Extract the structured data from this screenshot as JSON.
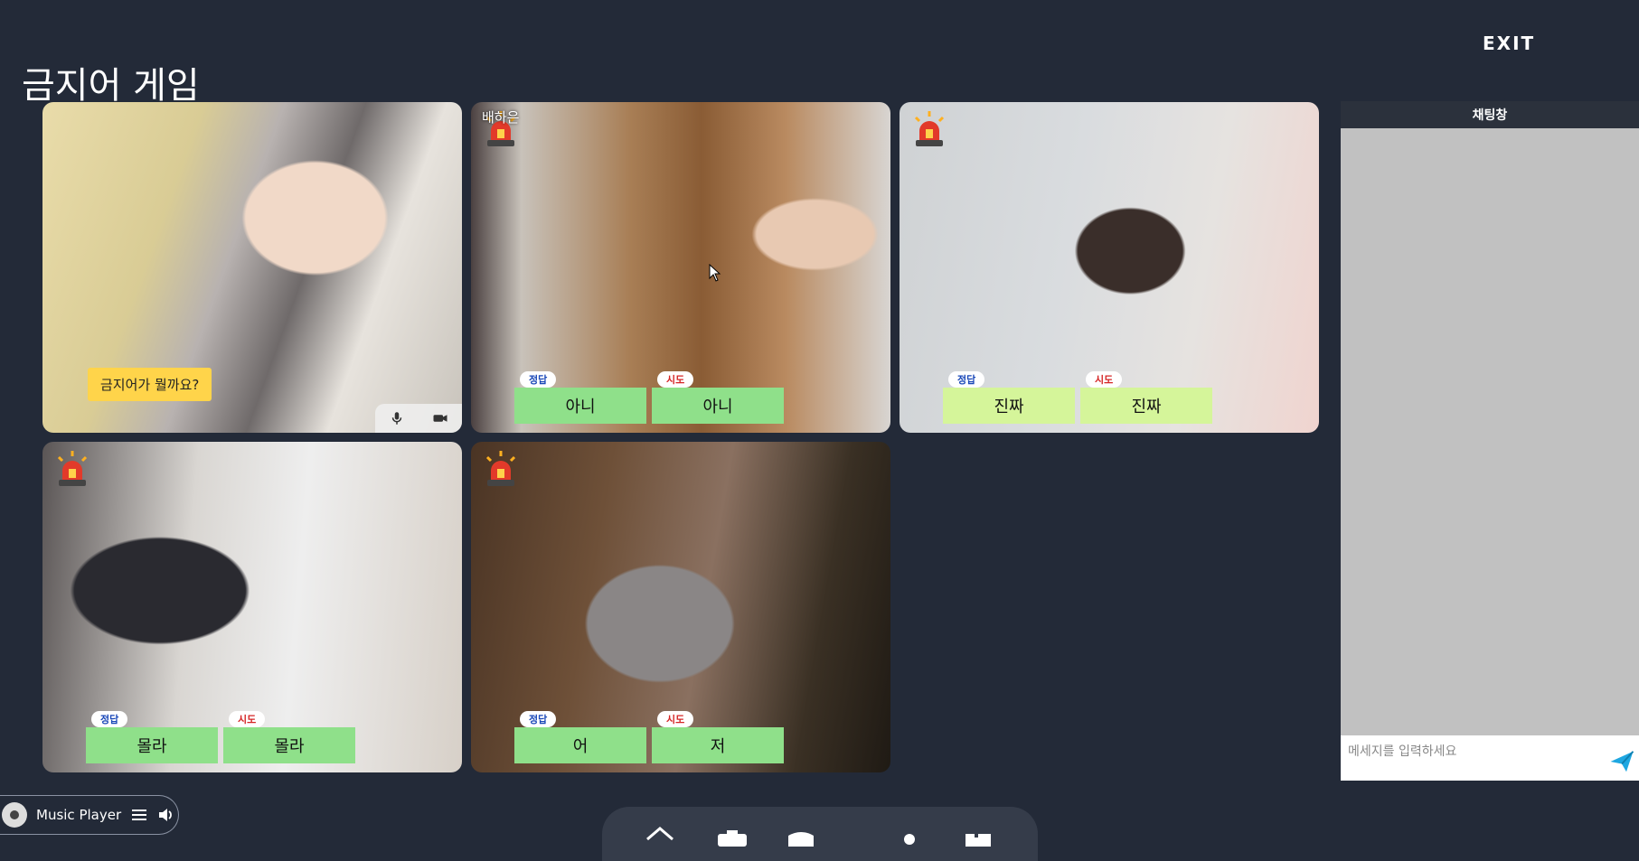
{
  "header": {
    "exit_label": "EXIT",
    "title": "금지어 게임"
  },
  "tiles": [
    {
      "name": "",
      "question": "금지어가 뭘까요?",
      "show_controls": true
    },
    {
      "name": "배하은",
      "correct_tag": "정답",
      "correct_answer": "아니",
      "attempt_tag": "시도",
      "attempt_answer": "아니"
    },
    {
      "name": "",
      "correct_tag": "정답",
      "correct_answer": "진짜",
      "attempt_tag": "시도",
      "attempt_answer": "진짜"
    },
    {
      "name": "",
      "correct_tag": "정답",
      "correct_answer": "몰라",
      "attempt_tag": "시도",
      "attempt_answer": "몰라"
    },
    {
      "name": "",
      "correct_tag": "정답",
      "correct_answer": "어",
      "attempt_tag": "시도",
      "attempt_answer": "저"
    }
  ],
  "chat": {
    "title": "채팅창",
    "placeholder": "메세지를 입력하세요"
  },
  "music_player": {
    "label": "Music Player"
  },
  "icons": {
    "siren": "siren-icon",
    "mic": "microphone-icon",
    "camera": "video-camera-icon",
    "send": "send-icon",
    "menu": "menu-icon",
    "volume": "volume-icon"
  },
  "colors": {
    "background": "#232a38",
    "answer_green": "#8fe08a",
    "answer_lime": "#d5f59a",
    "question_yellow": "#ffd44a",
    "send_blue": "#1ea7e1"
  }
}
